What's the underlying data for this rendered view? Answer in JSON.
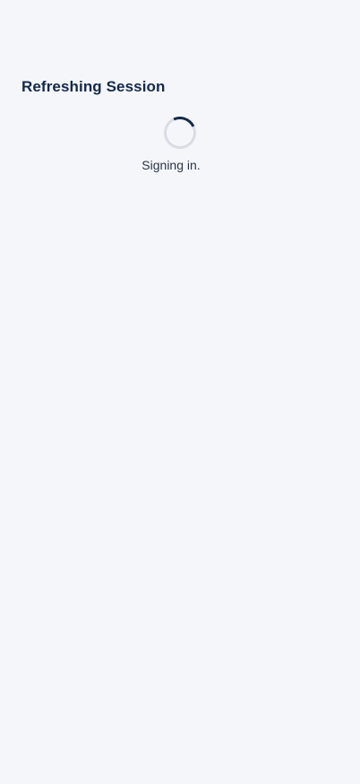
{
  "screen": {
    "title": "Refreshing Session",
    "status_text": "Signing in.",
    "spinner_icon": "loading-spinner-icon"
  },
  "colors": {
    "background": "#f4f6fa",
    "title": "#15294a",
    "spinner_track": "#d9dce3",
    "spinner_active": "#15294a",
    "status_text": "#2a3446"
  }
}
